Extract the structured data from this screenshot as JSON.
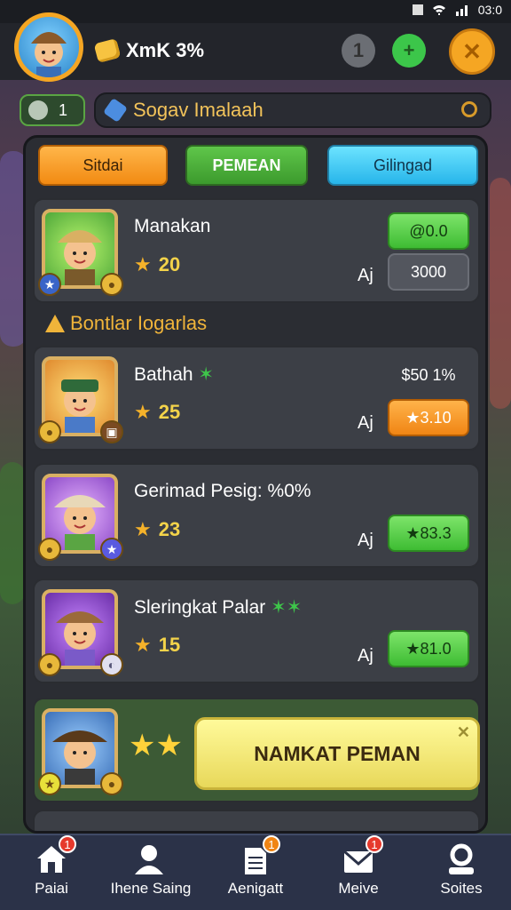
{
  "status": {
    "time": "03:0"
  },
  "topbar": {
    "currency": "XmK 3%",
    "grey_btn": "1",
    "green_btn": "+",
    "close_btn": "✕"
  },
  "secondbar": {
    "level": "1",
    "search_text": "Sogav Imalaah"
  },
  "tabs": [
    "Sitdai",
    "PEMEAN",
    "Gilingad"
  ],
  "section_title": "Bontlar Iogarlas",
  "cards": [
    {
      "name": "Manakan",
      "stars": "20",
      "mark": "Aj",
      "top_price": "@0.0",
      "bottom_price": "3000"
    },
    {
      "name": "Bathah",
      "stars": "25",
      "mark": "Aj",
      "top_price": "$50 1%",
      "bottom_price": "3.10"
    },
    {
      "name": "Gerimad Pesig: %0%",
      "stars": "23",
      "mark": "Aj",
      "top_price": "",
      "bottom_price": "83.3"
    },
    {
      "name": "Sleringkat Palar",
      "stars": "15",
      "mark": "Aj",
      "top_price": "",
      "bottom_price": "81.0"
    }
  ],
  "popup": {
    "label": "NAMKAT PEMAN"
  },
  "nav": [
    {
      "label": "Paiai",
      "badge": "1"
    },
    {
      "label": "Ihene Saing",
      "badge": ""
    },
    {
      "label": "Aenigatt",
      "badge": "1"
    },
    {
      "label": "Meive",
      "badge": "1"
    },
    {
      "label": "Soites",
      "badge": ""
    }
  ],
  "colors": {
    "accent_orange": "#f28a12",
    "accent_green": "#3ebc33",
    "accent_cyan": "#27b5ea"
  }
}
